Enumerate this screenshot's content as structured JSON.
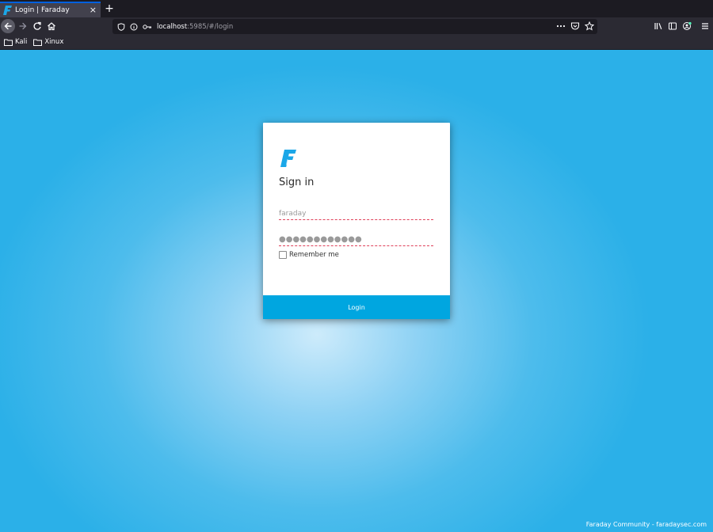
{
  "browser": {
    "tab_title": "Login | Faraday",
    "tab_close": "×",
    "new_tab": "+",
    "url_host": "localhost",
    "url_rest": ":5985/#/login",
    "bookmarks": [
      {
        "label": "Kali"
      },
      {
        "label": "Xinux"
      }
    ],
    "colors": {
      "tab_accent": "#0060df",
      "chrome_dark": "#1c1b22",
      "chrome": "#2b2a33"
    }
  },
  "login": {
    "heading": "Sign in",
    "username_value": "faraday",
    "password_value": "●●●●●●●●●●●●",
    "remember_label": "Remember me",
    "remember_checked": false,
    "button_label": "Login",
    "colors": {
      "brand_blue": "#00a6e0",
      "error_underline": "#e0415a"
    }
  },
  "footer": {
    "text": "Faraday Community - faradaysec.com"
  }
}
